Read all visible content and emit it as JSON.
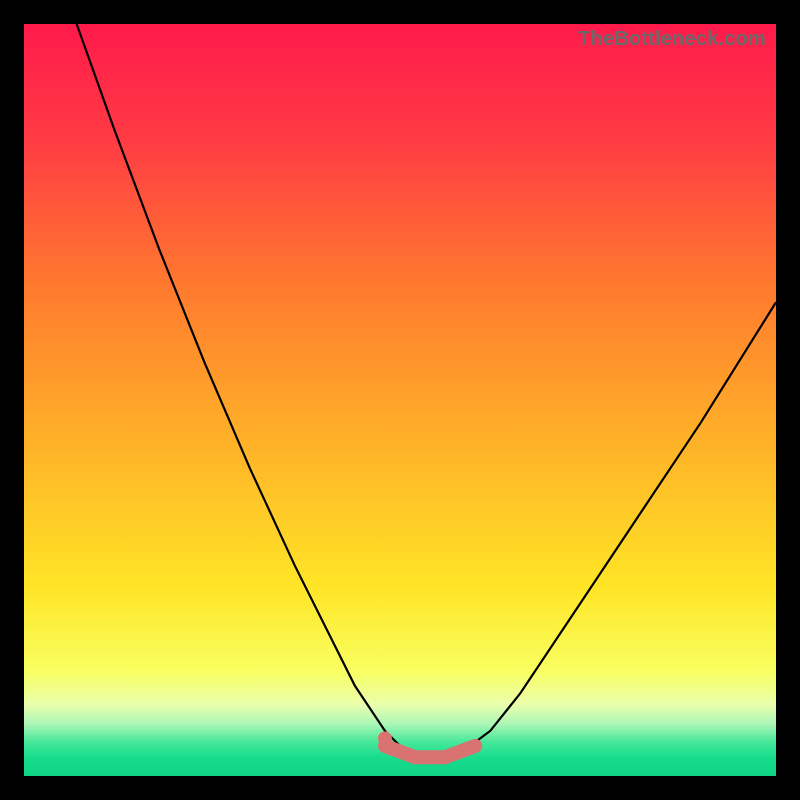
{
  "watermark": "TheBottleneck.com",
  "gradient_stops": [
    {
      "offset": 0.0,
      "color": "#ff1a4b"
    },
    {
      "offset": 0.15,
      "color": "#ff3a44"
    },
    {
      "offset": 0.35,
      "color": "#ff7a2e"
    },
    {
      "offset": 0.55,
      "color": "#ffb028"
    },
    {
      "offset": 0.75,
      "color": "#ffe526"
    },
    {
      "offset": 0.86,
      "color": "#f8ff60"
    },
    {
      "offset": 0.905,
      "color": "#eaffad"
    },
    {
      "offset": 0.93,
      "color": "#aef7b7"
    },
    {
      "offset": 0.955,
      "color": "#46e89a"
    },
    {
      "offset": 0.975,
      "color": "#18dc8c"
    },
    {
      "offset": 1.0,
      "color": "#0fd486"
    }
  ],
  "curve_color": "#000000",
  "curve_width": 2.2,
  "marker_color": "#d97372",
  "marker_dot_radius": 7,
  "marker_stroke_width": 14,
  "chart_data": {
    "type": "line",
    "title": "",
    "xlabel": "",
    "ylabel": "",
    "xlim": [
      0,
      100
    ],
    "ylim": [
      0,
      100
    ],
    "note": "Two curves descending into a shared valley near y≈0; highlighted flat segment along the valley floor roughly x≈48–60. Values are visual estimates (no axis tick labels present).",
    "series": [
      {
        "name": "left-curve",
        "x": [
          7,
          12,
          18,
          24,
          30,
          36,
          40,
          44,
          48,
          51,
          54
        ],
        "y": [
          100,
          86,
          70,
          55,
          41,
          28,
          20,
          12,
          6,
          3,
          2
        ]
      },
      {
        "name": "right-curve",
        "x": [
          54,
          58,
          62,
          66,
          72,
          80,
          90,
          100
        ],
        "y": [
          2,
          3,
          6,
          11,
          20,
          32,
          47,
          63
        ]
      }
    ],
    "highlight_segment": {
      "name": "valley-marker",
      "x": [
        48,
        52,
        56,
        60
      ],
      "y": [
        4,
        2.5,
        2.5,
        4
      ]
    },
    "highlight_dot": {
      "x": 48,
      "y": 5
    }
  }
}
